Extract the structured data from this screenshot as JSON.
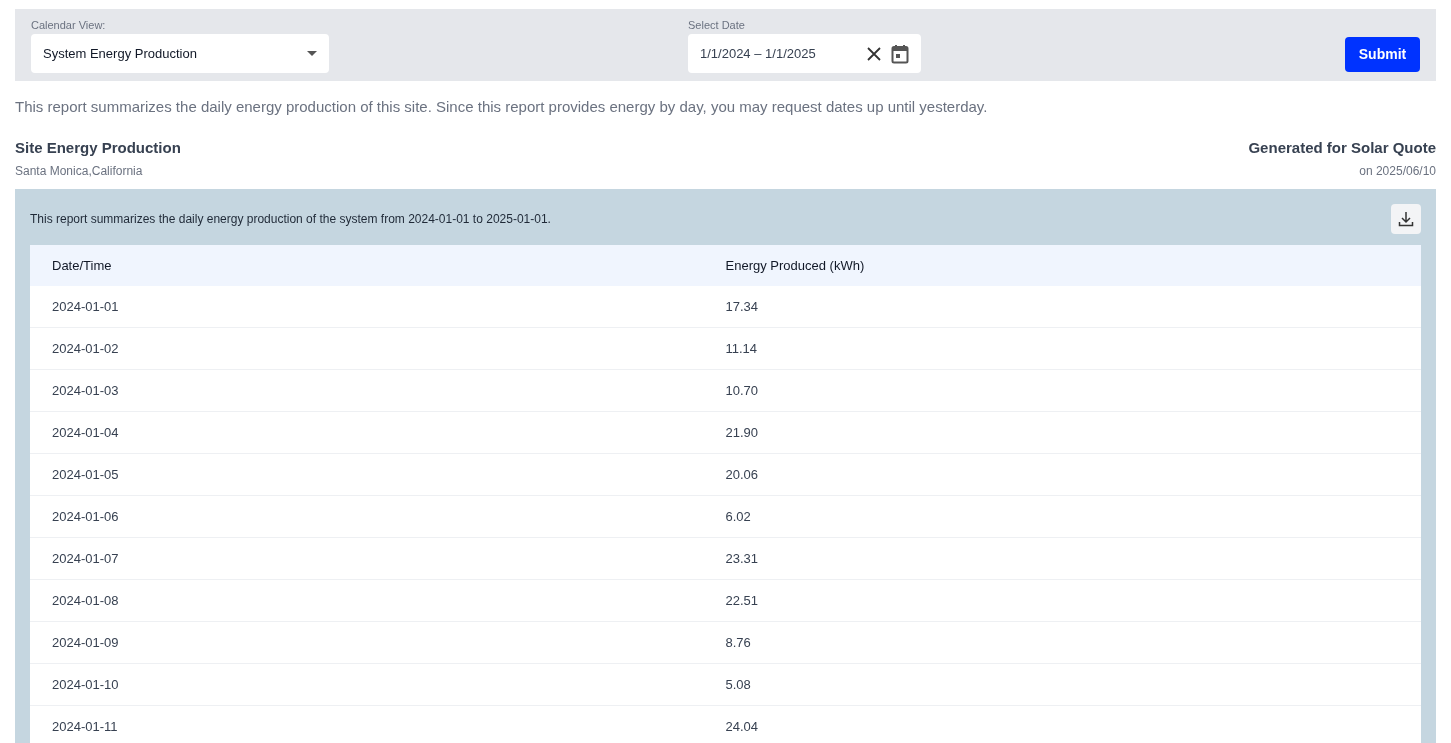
{
  "filters": {
    "calendar_view": {
      "label": "Calendar View:",
      "value": "System Energy Production"
    },
    "date": {
      "label": "Select Date",
      "value": "1/1/2024 – 1/1/2025"
    },
    "submit": "Submit"
  },
  "description": "This report summarizes the daily energy production of this site. Since this report provides energy by day, you may request dates up until yesterday.",
  "header": {
    "title": "Site Energy Production",
    "location": "Santa Monica,California",
    "generated_for": "Generated for Solar Quote",
    "generated_on": "on 2025/06/10"
  },
  "report": {
    "summary": "This report summarizes the daily energy production of the system from 2024-01-01 to 2025-01-01.",
    "table": {
      "columns": [
        "Date/Time",
        "Energy Produced (kWh)"
      ],
      "rows": [
        [
          "2024-01-01",
          "17.34"
        ],
        [
          "2024-01-02",
          "11.14"
        ],
        [
          "2024-01-03",
          "10.70"
        ],
        [
          "2024-01-04",
          "21.90"
        ],
        [
          "2024-01-05",
          "20.06"
        ],
        [
          "2024-01-06",
          "6.02"
        ],
        [
          "2024-01-07",
          "23.31"
        ],
        [
          "2024-01-08",
          "22.51"
        ],
        [
          "2024-01-09",
          "8.76"
        ],
        [
          "2024-01-10",
          "5.08"
        ],
        [
          "2024-01-11",
          "24.04"
        ]
      ]
    }
  }
}
